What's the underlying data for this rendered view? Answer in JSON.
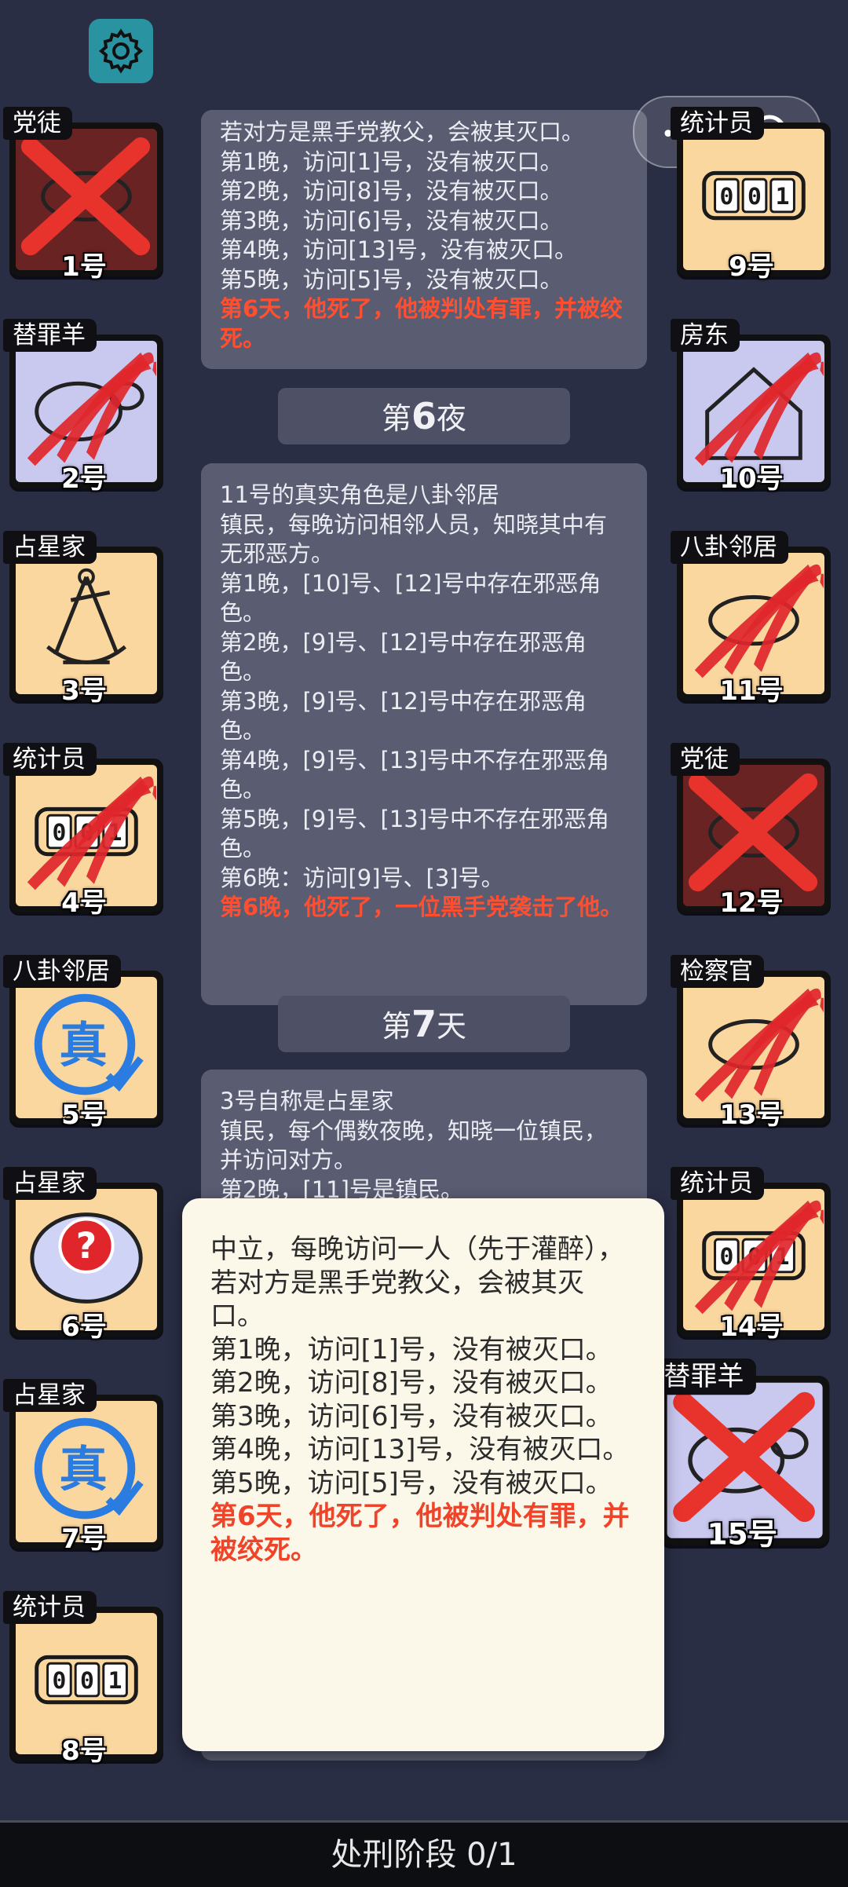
{
  "settings": {
    "icon": "gear-icon"
  },
  "capsule": {
    "menu_icon": "more-dots-icon",
    "close_icon": "target-circle-icon"
  },
  "players_left": [
    {
      "role": "党徒",
      "number": "1号",
      "art": "dark-x"
    },
    {
      "role": "替罪羊",
      "number": "2号",
      "art": "lav-claw"
    },
    {
      "role": "占星家",
      "number": "3号",
      "art": "sextant"
    },
    {
      "role": "统计员",
      "number": "4号",
      "art": "counter-claw"
    },
    {
      "role": "八卦邻居",
      "number": "5号",
      "art": "true-badge"
    },
    {
      "role": "占星家",
      "number": "6号",
      "art": "question"
    },
    {
      "role": "占星家",
      "number": "7号",
      "art": "true-badge"
    },
    {
      "role": "统计员",
      "number": "8号",
      "art": "counter"
    }
  ],
  "players_right": [
    {
      "role": "统计员",
      "number": "9号",
      "art": "counter"
    },
    {
      "role": "房东",
      "number": "10号",
      "art": "lav-claw"
    },
    {
      "role": "八卦邻居",
      "number": "11号",
      "art": "claw"
    },
    {
      "role": "党徒",
      "number": "12号",
      "art": "dark-x"
    },
    {
      "role": "检察官",
      "number": "13号",
      "art": "claw"
    },
    {
      "role": "统计员",
      "number": "14号",
      "art": "counter-claw"
    }
  ],
  "player_highlight": {
    "role": "替罪羊",
    "number": "15号",
    "art": "lav-x"
  },
  "log": {
    "block1": {
      "lines": [
        "若对方是黑手党教父，会被其灭口。",
        "第1晚，访问[1]号，没有被灭口。",
        "第2晚，访问[8]号，没有被灭口。",
        "第3晚，访问[6]号，没有被灭口。",
        "第4晚，访问[13]号，没有被灭口。",
        "第5晚，访问[5]号，没有被灭口。"
      ],
      "red": "第6天，他死了，他被判处有罪，并被绞死。"
    },
    "header1": {
      "prefix": "第",
      "num": "6",
      "suffix": "夜"
    },
    "block2": {
      "lines": [
        "11号的真实角色是八卦邻居",
        "镇民，每晚访问相邻人员，知晓其中有无邪恶方。",
        "第1晚，[10]号、[12]号中存在邪恶角色。",
        "第2晚，[9]号、[12]号中存在邪恶角色。",
        "第3晚，[9]号、[12]号中存在邪恶角色。",
        "第4晚，[9]号、[13]号中不存在邪恶角色。",
        "第5晚，[9]号、[13]号中不存在邪恶角色。",
        "第6晚：访问[9]号、[3]号。"
      ],
      "red": "第6晚，他死了，一位黑手党袭击了他。"
    },
    "header2": {
      "prefix": "第",
      "num": "7",
      "suffix": "天"
    },
    "block3": {
      "lines": [
        "3号自称是占星家",
        "镇民，每个偶数夜晚，知晓一位镇民，并访问对方。",
        "第2晚，[11]号是镇民。"
      ]
    }
  },
  "popup": {
    "lines": [
      "中立，每晚访问一人（先于灌醉），若对方是黑手党教父，会被其灭口。",
      "第1晚，访问[1]号，没有被灭口。",
      "第2晚，访问[8]号，没有被灭口。",
      "第3晚，访问[6]号，没有被灭口。",
      "第4晚，访问[13]号，没有被灭口。",
      "第5晚，访问[5]号，没有被灭口。"
    ],
    "red": "第6天，他死了，他被判处有罪，并被绞死。"
  },
  "status_bar": {
    "text": "处刑阶段 0/1"
  }
}
